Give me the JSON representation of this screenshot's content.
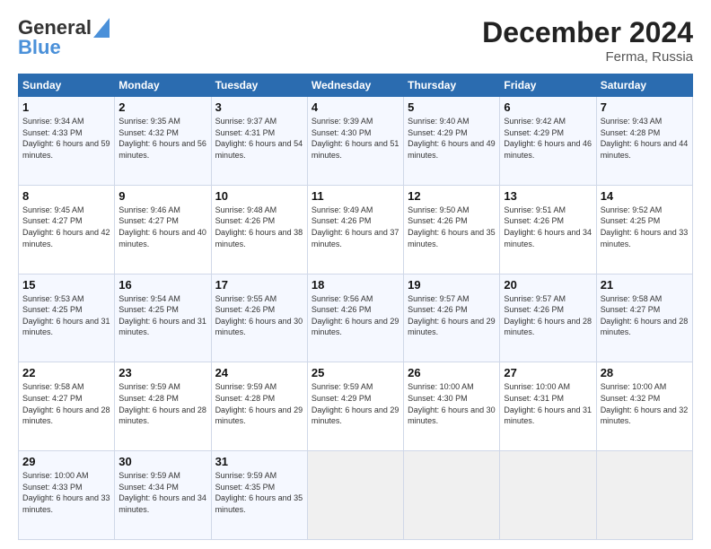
{
  "header": {
    "logo_line1": "General",
    "logo_line2": "Blue",
    "title": "December 2024",
    "subtitle": "Ferma, Russia"
  },
  "columns": [
    "Sunday",
    "Monday",
    "Tuesday",
    "Wednesday",
    "Thursday",
    "Friday",
    "Saturday"
  ],
  "weeks": [
    [
      {
        "day": "1",
        "sunrise": "Sunrise: 9:34 AM",
        "sunset": "Sunset: 4:33 PM",
        "daylight": "Daylight: 6 hours and 59 minutes."
      },
      {
        "day": "2",
        "sunrise": "Sunrise: 9:35 AM",
        "sunset": "Sunset: 4:32 PM",
        "daylight": "Daylight: 6 hours and 56 minutes."
      },
      {
        "day": "3",
        "sunrise": "Sunrise: 9:37 AM",
        "sunset": "Sunset: 4:31 PM",
        "daylight": "Daylight: 6 hours and 54 minutes."
      },
      {
        "day": "4",
        "sunrise": "Sunrise: 9:39 AM",
        "sunset": "Sunset: 4:30 PM",
        "daylight": "Daylight: 6 hours and 51 minutes."
      },
      {
        "day": "5",
        "sunrise": "Sunrise: 9:40 AM",
        "sunset": "Sunset: 4:29 PM",
        "daylight": "Daylight: 6 hours and 49 minutes."
      },
      {
        "day": "6",
        "sunrise": "Sunrise: 9:42 AM",
        "sunset": "Sunset: 4:29 PM",
        "daylight": "Daylight: 6 hours and 46 minutes."
      },
      {
        "day": "7",
        "sunrise": "Sunrise: 9:43 AM",
        "sunset": "Sunset: 4:28 PM",
        "daylight": "Daylight: 6 hours and 44 minutes."
      }
    ],
    [
      {
        "day": "8",
        "sunrise": "Sunrise: 9:45 AM",
        "sunset": "Sunset: 4:27 PM",
        "daylight": "Daylight: 6 hours and 42 minutes."
      },
      {
        "day": "9",
        "sunrise": "Sunrise: 9:46 AM",
        "sunset": "Sunset: 4:27 PM",
        "daylight": "Daylight: 6 hours and 40 minutes."
      },
      {
        "day": "10",
        "sunrise": "Sunrise: 9:48 AM",
        "sunset": "Sunset: 4:26 PM",
        "daylight": "Daylight: 6 hours and 38 minutes."
      },
      {
        "day": "11",
        "sunrise": "Sunrise: 9:49 AM",
        "sunset": "Sunset: 4:26 PM",
        "daylight": "Daylight: 6 hours and 37 minutes."
      },
      {
        "day": "12",
        "sunrise": "Sunrise: 9:50 AM",
        "sunset": "Sunset: 4:26 PM",
        "daylight": "Daylight: 6 hours and 35 minutes."
      },
      {
        "day": "13",
        "sunrise": "Sunrise: 9:51 AM",
        "sunset": "Sunset: 4:26 PM",
        "daylight": "Daylight: 6 hours and 34 minutes."
      },
      {
        "day": "14",
        "sunrise": "Sunrise: 9:52 AM",
        "sunset": "Sunset: 4:25 PM",
        "daylight": "Daylight: 6 hours and 33 minutes."
      }
    ],
    [
      {
        "day": "15",
        "sunrise": "Sunrise: 9:53 AM",
        "sunset": "Sunset: 4:25 PM",
        "daylight": "Daylight: 6 hours and 31 minutes."
      },
      {
        "day": "16",
        "sunrise": "Sunrise: 9:54 AM",
        "sunset": "Sunset: 4:25 PM",
        "daylight": "Daylight: 6 hours and 31 minutes."
      },
      {
        "day": "17",
        "sunrise": "Sunrise: 9:55 AM",
        "sunset": "Sunset: 4:26 PM",
        "daylight": "Daylight: 6 hours and 30 minutes."
      },
      {
        "day": "18",
        "sunrise": "Sunrise: 9:56 AM",
        "sunset": "Sunset: 4:26 PM",
        "daylight": "Daylight: 6 hours and 29 minutes."
      },
      {
        "day": "19",
        "sunrise": "Sunrise: 9:57 AM",
        "sunset": "Sunset: 4:26 PM",
        "daylight": "Daylight: 6 hours and 29 minutes."
      },
      {
        "day": "20",
        "sunrise": "Sunrise: 9:57 AM",
        "sunset": "Sunset: 4:26 PM",
        "daylight": "Daylight: 6 hours and 28 minutes."
      },
      {
        "day": "21",
        "sunrise": "Sunrise: 9:58 AM",
        "sunset": "Sunset: 4:27 PM",
        "daylight": "Daylight: 6 hours and 28 minutes."
      }
    ],
    [
      {
        "day": "22",
        "sunrise": "Sunrise: 9:58 AM",
        "sunset": "Sunset: 4:27 PM",
        "daylight": "Daylight: 6 hours and 28 minutes."
      },
      {
        "day": "23",
        "sunrise": "Sunrise: 9:59 AM",
        "sunset": "Sunset: 4:28 PM",
        "daylight": "Daylight: 6 hours and 28 minutes."
      },
      {
        "day": "24",
        "sunrise": "Sunrise: 9:59 AM",
        "sunset": "Sunset: 4:28 PM",
        "daylight": "Daylight: 6 hours and 29 minutes."
      },
      {
        "day": "25",
        "sunrise": "Sunrise: 9:59 AM",
        "sunset": "Sunset: 4:29 PM",
        "daylight": "Daylight: 6 hours and 29 minutes."
      },
      {
        "day": "26",
        "sunrise": "Sunrise: 10:00 AM",
        "sunset": "Sunset: 4:30 PM",
        "daylight": "Daylight: 6 hours and 30 minutes."
      },
      {
        "day": "27",
        "sunrise": "Sunrise: 10:00 AM",
        "sunset": "Sunset: 4:31 PM",
        "daylight": "Daylight: 6 hours and 31 minutes."
      },
      {
        "day": "28",
        "sunrise": "Sunrise: 10:00 AM",
        "sunset": "Sunset: 4:32 PM",
        "daylight": "Daylight: 6 hours and 32 minutes."
      }
    ],
    [
      {
        "day": "29",
        "sunrise": "Sunrise: 10:00 AM",
        "sunset": "Sunset: 4:33 PM",
        "daylight": "Daylight: 6 hours and 33 minutes."
      },
      {
        "day": "30",
        "sunrise": "Sunrise: 9:59 AM",
        "sunset": "Sunset: 4:34 PM",
        "daylight": "Daylight: 6 hours and 34 minutes."
      },
      {
        "day": "31",
        "sunrise": "Sunrise: 9:59 AM",
        "sunset": "Sunset: 4:35 PM",
        "daylight": "Daylight: 6 hours and 35 minutes."
      },
      null,
      null,
      null,
      null
    ]
  ]
}
